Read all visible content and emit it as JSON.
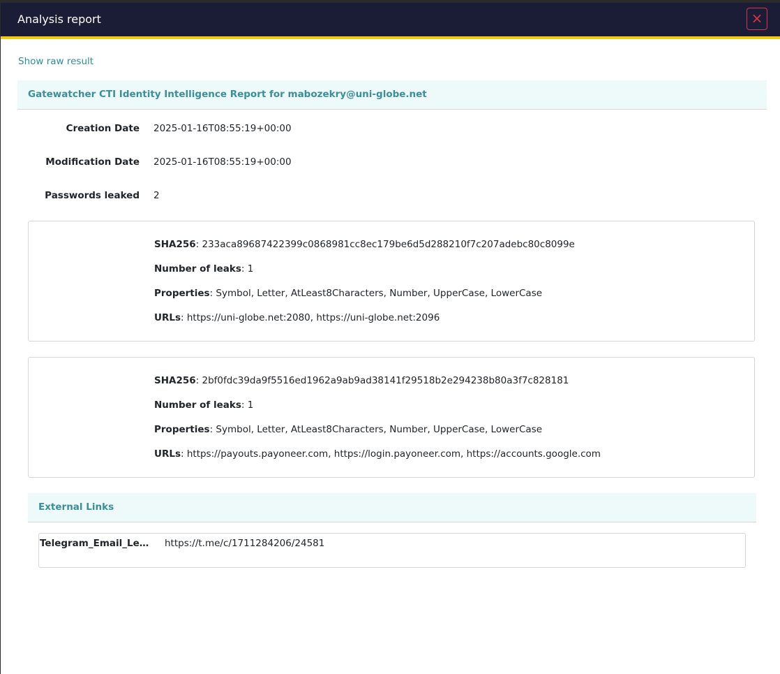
{
  "modal": {
    "title": "Analysis report",
    "close_icon": "×"
  },
  "raw_link": "Show raw result",
  "report": {
    "title": "Gatewatcher CTI Identity Intelligence Report for mabozekry@uni-globe.net",
    "fields": [
      {
        "label": "Creation Date",
        "value": "2025-01-16T08:55:19+00:00"
      },
      {
        "label": "Modification Date",
        "value": "2025-01-16T08:55:19+00:00"
      },
      {
        "label": "Passwords leaked",
        "value": "2"
      }
    ]
  },
  "passwords": [
    {
      "sha256_label": "SHA256",
      "sha256": "233aca89687422399c0868981cc8ec179be6d5d288210f7c207adebc80c8099e",
      "leaks_label": "Number of leaks",
      "leaks": "1",
      "properties_label": "Properties",
      "properties": "Symbol, Letter, AtLeast8Characters, Number, UpperCase, LowerCase",
      "urls_label": "URLs",
      "urls": "https://uni-globe.net:2080, https://uni-globe.net:2096"
    },
    {
      "sha256_label": "SHA256",
      "sha256": "2bf0fdc39da9f5516ed1962a9ab9ad38141f29518b2e294238b80a3f7c828181",
      "leaks_label": "Number of leaks",
      "leaks": "1",
      "properties_label": "Properties",
      "properties": "Symbol, Letter, AtLeast8Characters, Number, UpperCase, LowerCase",
      "urls_label": "URLs",
      "urls": "https://payouts.payoneer.com, https://login.payoneer.com, https://accounts.google.com"
    }
  ],
  "external_links": {
    "title": "External Links",
    "items": [
      {
        "name": "Telegram_Email_Leak...",
        "url": "https://t.me/c/1711284206/24581"
      }
    ]
  },
  "colors": {
    "header_bg": "#1b1c35",
    "header_accent": "#f2cc0c",
    "teal": "#3a8f99",
    "close_red": "#dc3545"
  }
}
